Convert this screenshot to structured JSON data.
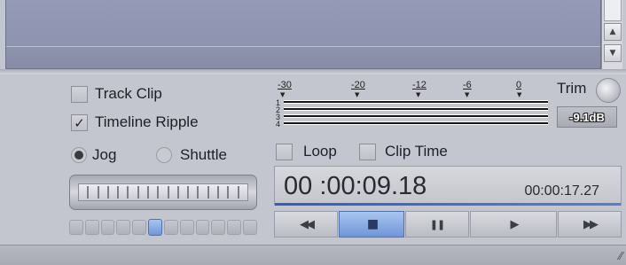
{
  "window": {
    "scroll_up_icon": "▲",
    "scroll_down_icon": "▼"
  },
  "options": {
    "track_clip": {
      "label": "Track Clip",
      "checked": false
    },
    "timeline_ripple": {
      "label": "Timeline Ripple",
      "checked": true,
      "mark": "✓"
    },
    "jog": {
      "label": "Jog",
      "selected": true
    },
    "shuttle": {
      "label": "Shuttle",
      "selected": false
    },
    "loop": {
      "label": "Loop",
      "checked": false
    },
    "clip_time": {
      "label": "Clip Time",
      "checked": false
    }
  },
  "meter": {
    "scale": [
      "-30",
      "-20",
      "-12",
      "-6",
      "0"
    ],
    "tick_marker": "▼",
    "channels": [
      "1",
      "2",
      "3",
      "4"
    ],
    "trim_label": "Trim",
    "level_readout": "-9.1dB"
  },
  "timecode": {
    "current": "00 :00:09.18",
    "duration": "00:00:17.27"
  },
  "jog_slider": {
    "cell_count": 12,
    "active_cell_index": 5
  },
  "transport": {
    "rewind_icon": "◀◀",
    "stop_icon": "■",
    "pause_icon": "❚❚",
    "play_icon": "▶",
    "fast_forward_icon": "▶▶",
    "active_button": "stop"
  },
  "status": {
    "grip_icon": "⁄⁄"
  }
}
